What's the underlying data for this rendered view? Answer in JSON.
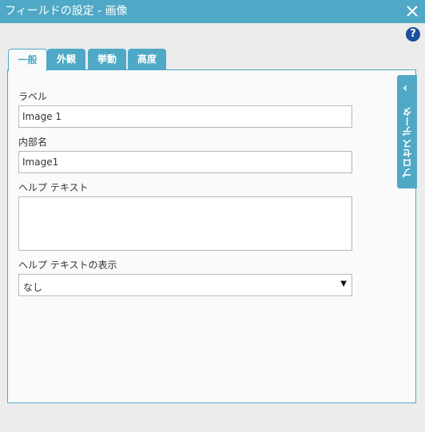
{
  "window": {
    "title": "フィールドの設定 - 画像"
  },
  "help": {
    "glyph": "?"
  },
  "tabs": [
    {
      "label": "一般",
      "active": true
    },
    {
      "label": "外観",
      "active": false
    },
    {
      "label": "挙動",
      "active": false
    },
    {
      "label": "高度",
      "active": false
    }
  ],
  "form": {
    "label_field": {
      "label": "ラベル",
      "value": "Image 1"
    },
    "internal_name": {
      "label": "内部名",
      "value": "Image1"
    },
    "help_text": {
      "label": "ヘルプ テキスト",
      "value": ""
    },
    "help_display": {
      "label": "ヘルプ テキストの表示",
      "value": "なし"
    }
  },
  "side_panel": {
    "label": "プロセス データ"
  },
  "colors": {
    "accent": "#4fa9c6",
    "help_icon": "#1c4f9c"
  }
}
